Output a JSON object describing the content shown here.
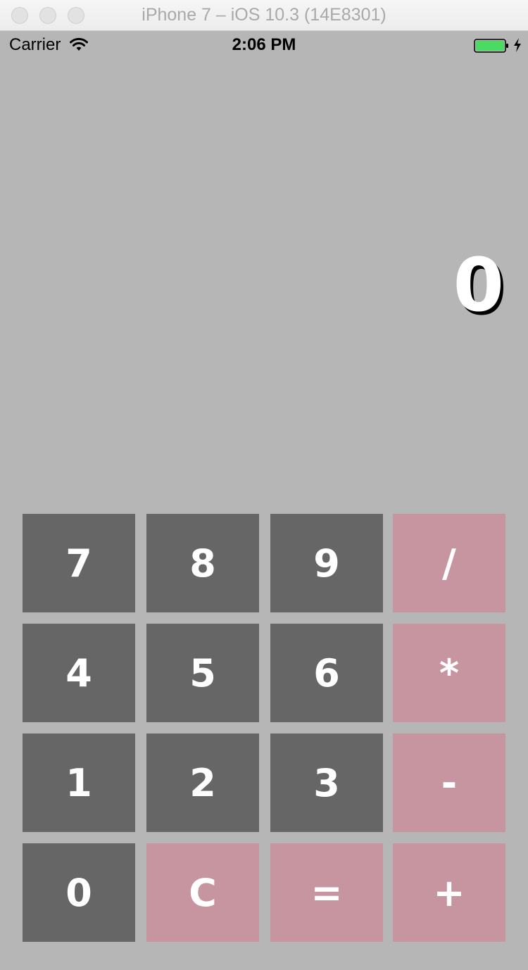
{
  "window": {
    "title": "iPhone 7 – iOS 10.3 (14E8301)"
  },
  "status_bar": {
    "carrier": "Carrier",
    "time": "2:06 PM",
    "battery_color": "#4cd964"
  },
  "display": {
    "value": "0"
  },
  "keypad": {
    "keys": [
      "7",
      "8",
      "9",
      "/",
      "4",
      "5",
      "6",
      "*",
      "1",
      "2",
      "3",
      "-",
      "0",
      "C",
      "=",
      "+"
    ]
  },
  "colors": {
    "background": "#b6b6b6",
    "number_key": "#666666",
    "operator_key": "#c695a0",
    "key_text": "#ffffff"
  }
}
